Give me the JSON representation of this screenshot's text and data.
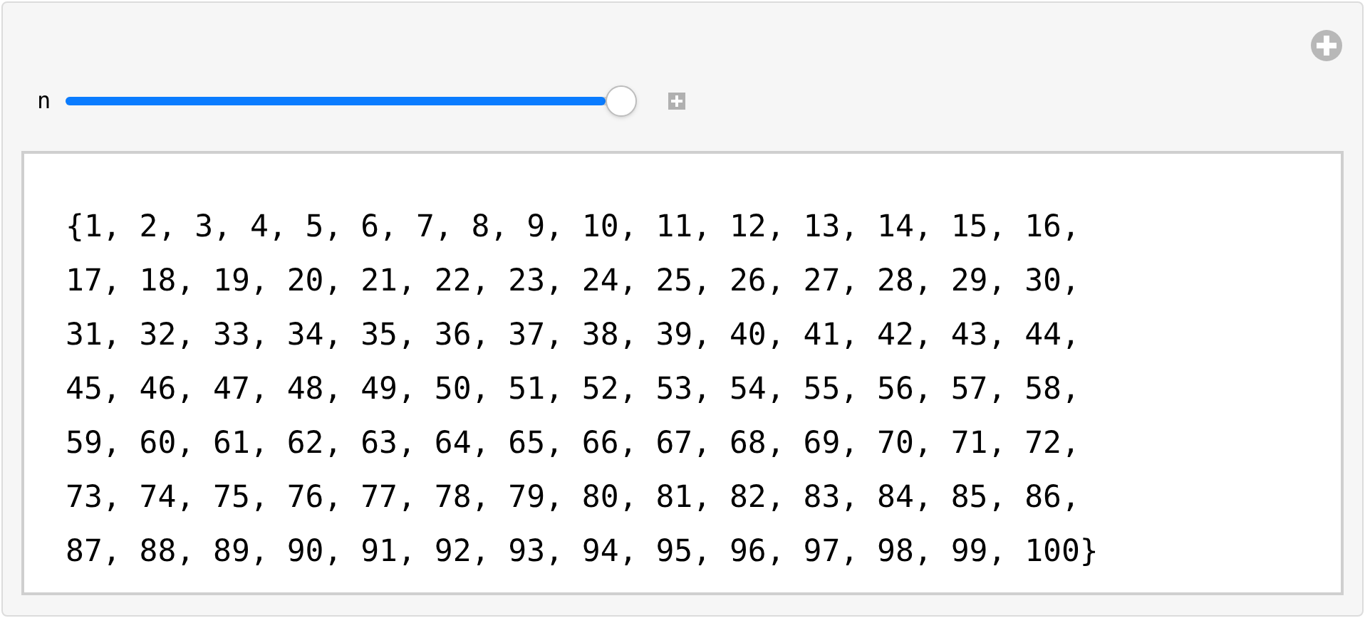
{
  "control": {
    "label": "n",
    "level": 1.0
  },
  "output": {
    "lines": [
      "{1, 2, 3, 4, 5, 6, 7, 8, 9, 10, 11, 12, 13, 14, 15, 16,",
      "17, 18, 19, 20, 21, 22, 23, 24, 25, 26, 27, 28, 29, 30,",
      "31, 32, 33, 34, 35, 36, 37, 38, 39, 40, 41, 42, 43, 44,",
      "45, 46, 47, 48, 49, 50, 51, 52, 53, 54, 55, 56, 57, 58,",
      "59, 60, 61, 62, 63, 64, 65, 66, 67, 68, 69, 70, 71, 72,",
      "73, 74, 75, 76, 77, 78, 79, 80, 81, 82, 83, 84, 85, 86,",
      "87, 88, 89, 90, 91, 92, 93, 94, 95, 96, 97, 98, 99, 100}"
    ]
  }
}
